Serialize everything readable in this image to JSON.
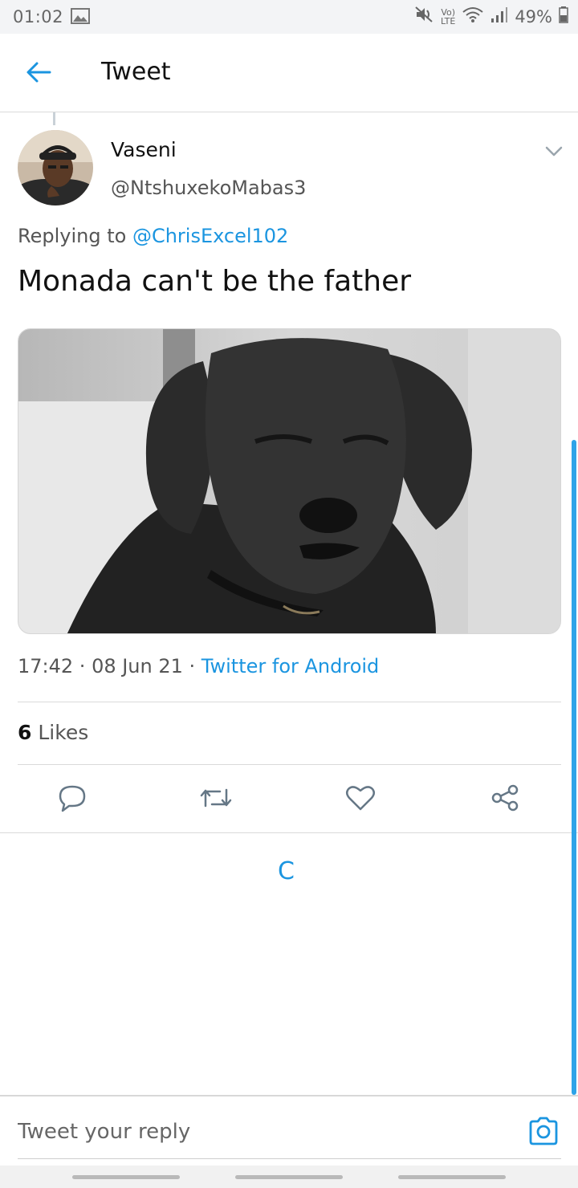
{
  "status_bar": {
    "time": "01:02",
    "lte_line1": "Vo)",
    "lte_line2": "LTE",
    "battery": "49%"
  },
  "header": {
    "title": "Tweet"
  },
  "tweet": {
    "author_name": "Vaseni",
    "author_handle": "@NtshuxekoMabas3",
    "replying_prefix": "Replying to ",
    "replying_handle": "@ChrisExcel102",
    "text": "Monada can't be the father",
    "time": "17:42",
    "separator1": " · ",
    "date": "08 Jun 21",
    "separator2": " · ",
    "source": "Twitter for Android",
    "likes_count": "6",
    "likes_label": " Likes"
  },
  "loading": {
    "glyph": "C"
  },
  "reply": {
    "placeholder": "Tweet your reply"
  },
  "icons": {
    "back": "arrow-left-icon",
    "chevron": "chevron-down-icon",
    "reply": "comment-icon",
    "retweet": "retweet-icon",
    "like": "heart-icon",
    "share": "share-icon",
    "camera": "camera-icon"
  },
  "colors": {
    "accent": "#1b95e0",
    "text": "#111111",
    "muted": "#555555",
    "divider": "#dadada"
  }
}
